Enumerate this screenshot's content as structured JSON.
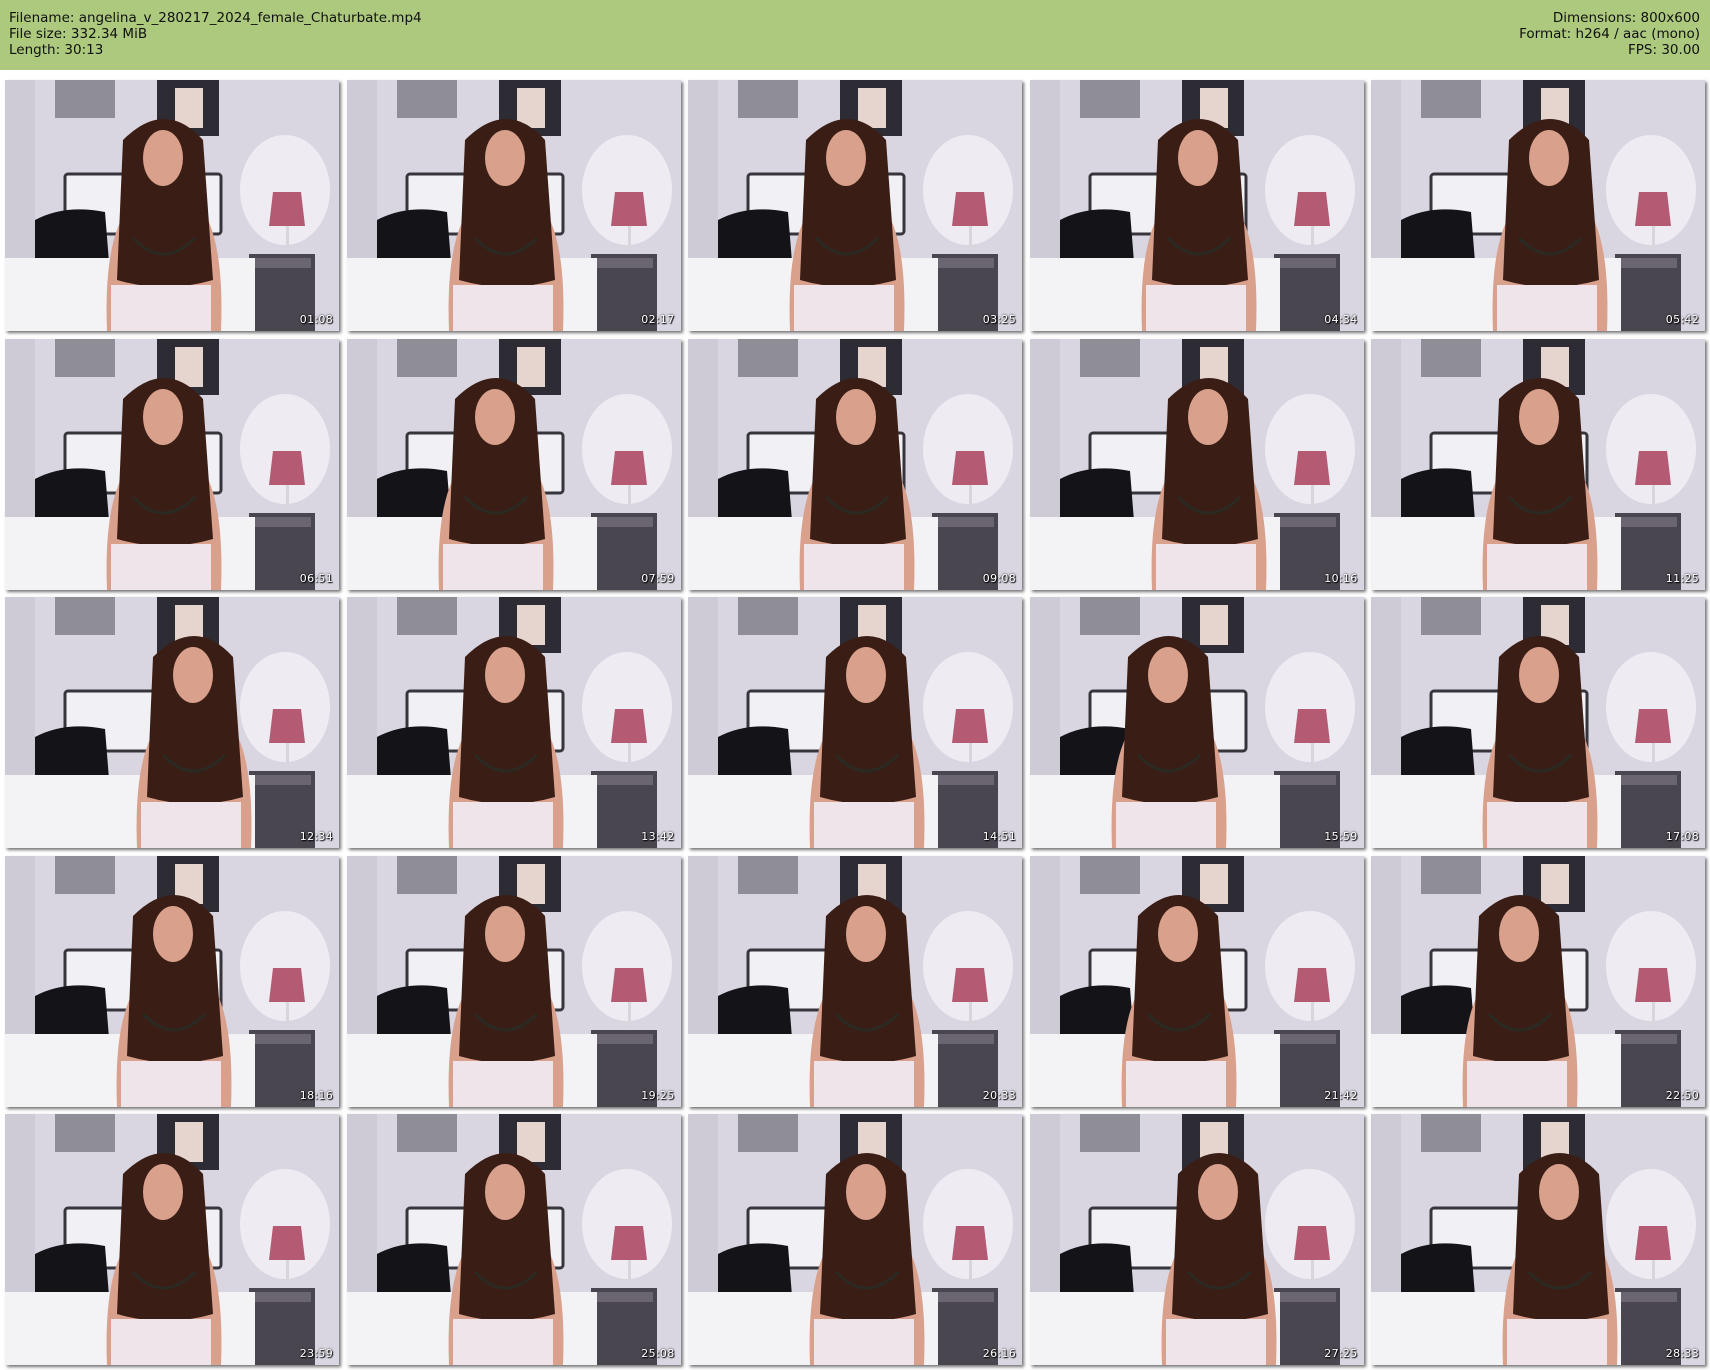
{
  "header": {
    "left": [
      "Filename: angelina_v_280217_2024_female_Chaturbate.mp4",
      "File size: 332.34 MiB",
      "Length: 30:13"
    ],
    "right": [
      "Dimensions: 800x600",
      "Format: h264 / aac (mono)",
      "FPS: 30.00"
    ]
  },
  "thumbnails": [
    {
      "time": "01:08"
    },
    {
      "time": "02:17"
    },
    {
      "time": "03:25"
    },
    {
      "time": "04:34"
    },
    {
      "time": "05:42"
    },
    {
      "time": "06:51"
    },
    {
      "time": "07:59"
    },
    {
      "time": "09:08"
    },
    {
      "time": "10:16"
    },
    {
      "time": "11:25"
    },
    {
      "time": "12:34"
    },
    {
      "time": "13:42"
    },
    {
      "time": "14:51"
    },
    {
      "time": "15:59"
    },
    {
      "time": "17:08"
    },
    {
      "time": "18:16"
    },
    {
      "time": "19:25"
    },
    {
      "time": "20:33"
    },
    {
      "time": "21:42"
    },
    {
      "time": "22:50"
    },
    {
      "time": "23:59"
    },
    {
      "time": "25:08"
    },
    {
      "time": "26:16"
    },
    {
      "time": "27:25"
    },
    {
      "time": "28:33"
    }
  ],
  "colors": {
    "header_bg": "#acc97e",
    "wall": "#d9d6e2",
    "lamp_shade": "#b45a72",
    "pillow": "#141418",
    "bed": "#f3f3f6",
    "hair": "#3a1e16",
    "skin": "#d9a08c"
  }
}
